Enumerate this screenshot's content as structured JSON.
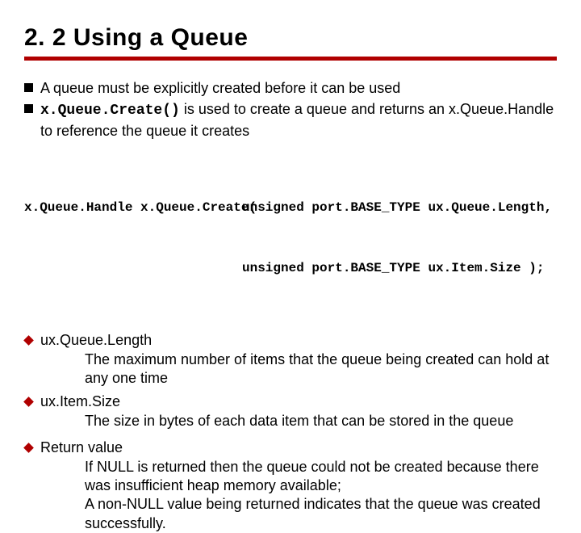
{
  "title": "2. 2 Using a Queue",
  "bullets": [
    {
      "pre": "A queue must be explicitly created before it can be used",
      "code": "",
      "post": ""
    },
    {
      "pre": "",
      "code": "x.Queue.Create()",
      "post": " is used to create a queue and returns an x.Queue.Handle to reference the queue it creates"
    }
  ],
  "signature": {
    "left": "x.Queue.Handle x.Queue.Create(",
    "line1_right": "unsigned port.BASE_TYPE ux.Queue.Length,",
    "line2_right": "unsigned port.BASE_TYPE ux.Item.Size );"
  },
  "params": [
    {
      "name": "ux.Queue.Length",
      "desc": "The maximum number of items that the queue being created can hold at any one time"
    },
    {
      "name": "ux.Item.Size",
      "desc": "The size in bytes of each data item that can be stored in the queue"
    },
    {
      "name": "Return value",
      "desc": "If NULL is returned then the queue could not be created because there was insufficient heap memory available;\nA non-NULL value being returned indicates that the queue was created successfully."
    }
  ]
}
